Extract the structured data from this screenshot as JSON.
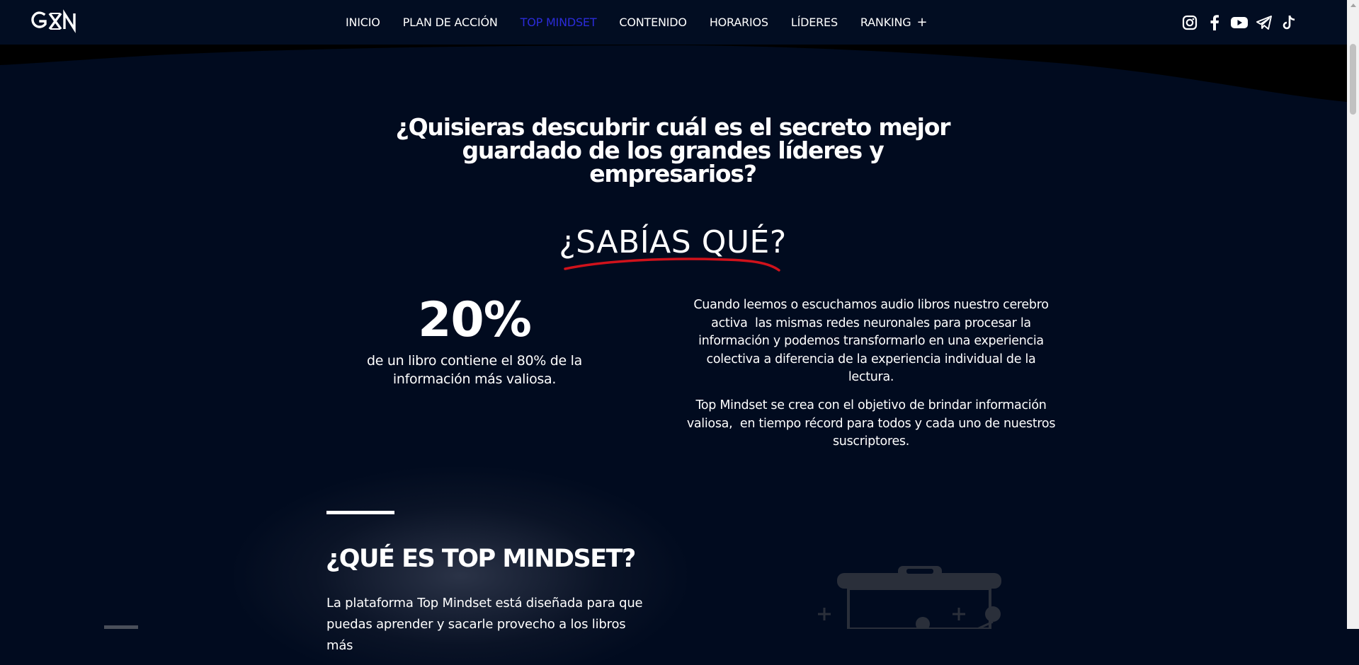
{
  "header": {
    "logo_text": "GXN",
    "nav": [
      {
        "label": "INICIO",
        "active": false
      },
      {
        "label": "PLAN DE ACCIÓN",
        "active": false
      },
      {
        "label": "TOP MINDSET",
        "active": true
      },
      {
        "label": "CONTENIDO",
        "active": false
      },
      {
        "label": "HORARIOS",
        "active": false
      },
      {
        "label": "LÍDERES",
        "active": false
      },
      {
        "label": "RANKING",
        "active": false,
        "expander": "+"
      }
    ],
    "social_icons": [
      "instagram-icon",
      "facebook-icon",
      "youtube-icon",
      "telegram-icon",
      "tiktok-icon"
    ]
  },
  "hero": {
    "title_lines": [
      "¿Quisieras descubrir cuál es el secreto mejor",
      "guardado de los grandes líderes y",
      "empresarios?"
    ]
  },
  "sabias": {
    "heading": "¿SABÍAS QUÉ?",
    "underline_color": "#d0121b"
  },
  "stat": {
    "number": "20%",
    "desc_lines": [
      "de un libro contiene el 80% de la",
      "información más valiosa."
    ]
  },
  "paragraphs": {
    "p1_lines": [
      "Cuando leemos o escuchamos audio libros nuestro cerebro",
      "activa  las mismas redes neuronales para procesar la",
      "información y podemos transformarlo en una experiencia",
      "colectiva a diferencia de la experiencia individual de la",
      "lectura."
    ],
    "p2_lines": [
      "Top Mindset se crea con el objetivo de brindar información",
      "valiosa,  en tiempo récord para todos y cada uno de nuestros",
      "suscriptores."
    ]
  },
  "top_mindset": {
    "title": "¿QUÉ ES TOP MINDSET?",
    "text_lines": [
      "La plataforma Top Mindset está diseñada para que",
      "puedas aprender y sacarle provecho a los libros más"
    ]
  },
  "colors": {
    "background": "#010b1f",
    "header": "#020d22",
    "active_nav": "#2b2bd8",
    "text": "#ffffff"
  }
}
